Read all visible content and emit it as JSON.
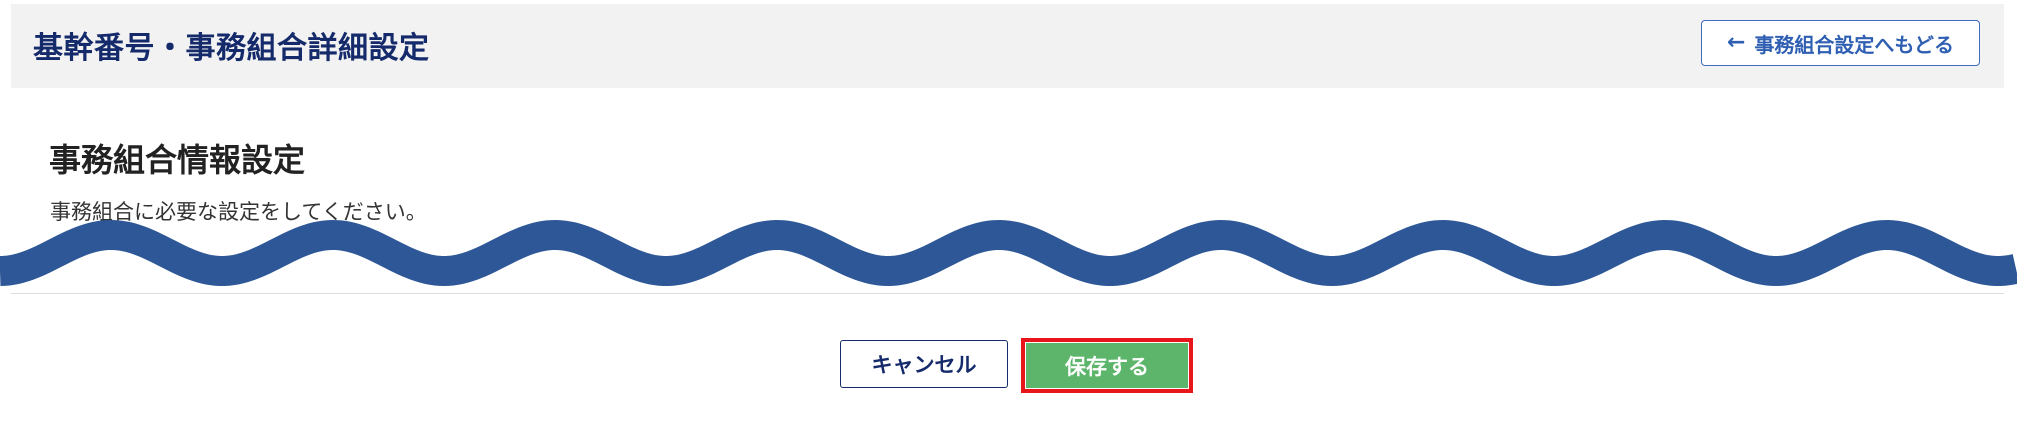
{
  "header": {
    "title": "基幹番号・事務組合詳細設定",
    "back_button": {
      "icon": "arrow-left-icon",
      "label": "事務組合設定へもどる"
    }
  },
  "section": {
    "title": "事務組合情報設定",
    "description": "事務組合に必要な設定をしてください。"
  },
  "actions": {
    "cancel_label": "キャンセル",
    "save_label": "保存する"
  },
  "colors": {
    "title": "#142a6b",
    "header_bg": "#f2f2f2",
    "link_blue": "#2f5fb2",
    "save_green": "#5cb56a",
    "highlight_red": "#e8161a",
    "wave_blue": "#2e5797"
  }
}
